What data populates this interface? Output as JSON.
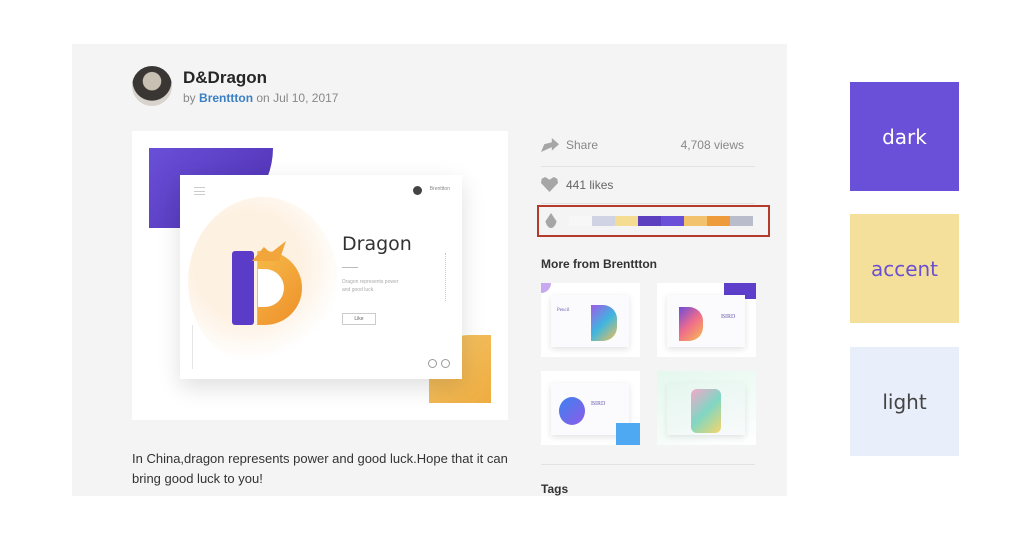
{
  "shot": {
    "title": "D&Dragon",
    "by_label": "by",
    "author": "Brenttton",
    "on_label": "on",
    "date": "Jul 10, 2017",
    "description": "In China,dragon represents power and good luck.Hope that it can bring good luck to you!",
    "mock": {
      "user": "Brenttton",
      "title": "Dragon",
      "desc": "Dragon represents power and good luck.",
      "button": "Like"
    }
  },
  "sidebar": {
    "share_label": "Share",
    "views": "4,708 views",
    "likes": "441 likes",
    "palette": [
      "#f7f7f7",
      "#cfd3e3",
      "#f4dc93",
      "#5b3fbf",
      "#6a4fd8",
      "#f2c36c",
      "#ee9b3b",
      "#b9bccb"
    ],
    "more_title": "More from Brenttton",
    "thumbnails": [
      {
        "text": "Pencil"
      },
      {
        "text": "BIRD"
      },
      {
        "text": "BIRD"
      },
      {
        "text": ""
      }
    ],
    "tags_title": "Tags"
  },
  "colors": {
    "dark": {
      "label": "dark",
      "hex": "#6a4fd8"
    },
    "accent": {
      "label": "accent",
      "hex": "#f4e09a"
    },
    "light": {
      "label": "light",
      "hex": "#e8eefa"
    }
  }
}
